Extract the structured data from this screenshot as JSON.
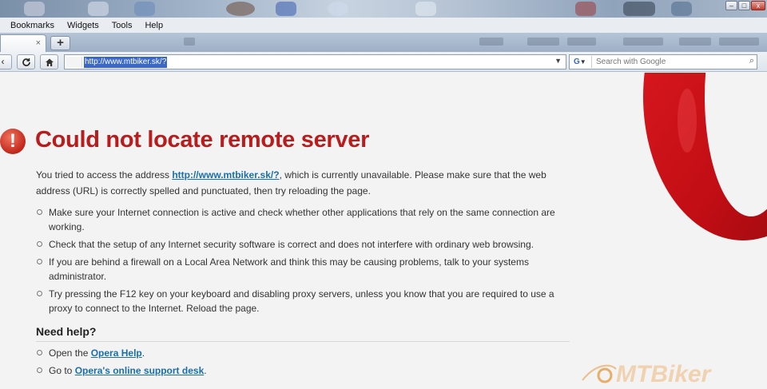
{
  "menubar": {
    "items": [
      "Bookmarks",
      "Widgets",
      "Tools",
      "Help"
    ]
  },
  "tabbar": {
    "new_tab_label": "+",
    "close_label": "×"
  },
  "window": {
    "minimize": "–",
    "maximize": "□",
    "close": "x"
  },
  "toolbar": {
    "back_icon": "back-arrow-icon",
    "reload_icon": "reload-icon",
    "home_icon": "home-icon"
  },
  "address": {
    "url": "http://www.mtbiker.sk/?"
  },
  "search": {
    "engine": "G",
    "placeholder": "Search with Google"
  },
  "error": {
    "title": "Could not locate remote server",
    "intro_before": "You tried to access the address ",
    "intro_link": "http://www.mtbiker.sk/?",
    "intro_after": ", which is currently unavailable. Please make sure that the web address (URL) is correctly spelled and punctuated, then try reloading the page.",
    "tips": [
      "Make sure your Internet connection is active and check whether other applications that rely on the same connection are working.",
      "Check that the setup of any Internet security software is correct and does not interfere with ordinary web browsing.",
      "If you are behind a firewall on a Local Area Network and think this may be causing problems, talk to your systems administrator.",
      "Try pressing the F12 key on your keyboard and disabling proxy servers, unless you know that you are required to use a proxy to connect to the Internet. Reload the page."
    ]
  },
  "help": {
    "title": "Need help?",
    "item1_before": "Open the ",
    "item1_link": "Opera Help",
    "item1_after": ".",
    "item2_before": "Go to ",
    "item2_link": "Opera's online support desk",
    "item2_after": "."
  },
  "watermark": {
    "text": "MTBiker"
  },
  "colors": {
    "title_red": "#b81c1c",
    "link_blue": "#1a6fa8",
    "opera_red": "#cc0f16"
  }
}
